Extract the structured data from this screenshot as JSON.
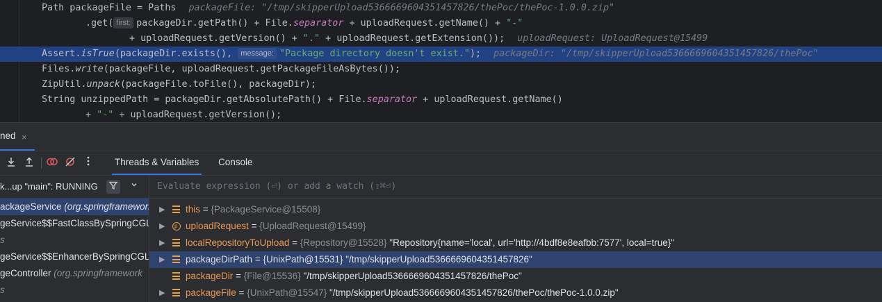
{
  "editor": {
    "lines": [
      {
        "parts": [
          "Path packageFile = Paths"
        ],
        "debug": "packageFile: \"/tmp/skipperUpload5366669604351457826/thePoc/thePoc-1.0.0.zip\""
      },
      {
        "pre": ".get(",
        "hint": "first:",
        "post_a": "packageDir.getPath() + File.",
        "field": "separator",
        "post_b": " + uploadRequest.getName() + ",
        "str": "\"-\""
      },
      {
        "pre": "+ uploadRequest.getVersion() + ",
        "str": "\".\"",
        "post": " + uploadRequest.getExtension());",
        "debug": "uploadRequest: UploadRequest@15499"
      },
      {
        "pre": "Assert.",
        "method": "isTrue",
        "post": "(packageDir.exists(), ",
        "hint": "message:",
        "str": "\"Package directory doesn't exist.\"",
        "end": ");",
        "debug": "packageDir: \"/tmp/skipperUpload5366669604351457826/thePoc\""
      },
      {
        "pre": "Files.",
        "method": "write",
        "post": "(packageFile, uploadRequest.getPackageFileAsBytes());"
      },
      {
        "pre": "ZipUtil.",
        "method": "unpack",
        "post": "(packageFile.toFile(), packageDir);"
      },
      {
        "pre": "String unzippedPath = packageDir.getAbsolutePath() + File.",
        "field": "separator",
        "post": " + uploadRequest.getName()"
      },
      {
        "pre": "+ ",
        "str": "\"-\"",
        "post": " + uploadRequest.getVersion();"
      }
    ]
  },
  "debug": {
    "session_tab": "ned",
    "close_glyph": "×",
    "tabs": [
      "Threads & Variables",
      "Console"
    ],
    "thread_label": "k...up \"main\": RUNNING",
    "frames": [
      {
        "name": "ackageService",
        "pkg": " (org.springframework."
      },
      {
        "name": "geService$$FastClassBySpringCGL",
        "pkg": ""
      },
      {
        "name": "s",
        "pkg": ""
      },
      {
        "name": "geService$$EnhancerBySpringCGL",
        "pkg": ""
      },
      {
        "name": "geController",
        "pkg": " (org.springframework"
      },
      {
        "name": "s",
        "pkg": ""
      }
    ],
    "eval_placeholder": "Evaluate expression (⏎) or add a watch (⇧⌘⏎)",
    "variables": [
      {
        "icon": "field",
        "name": "this",
        "type": "{PackageService@15508}",
        "value": ""
      },
      {
        "icon": "param",
        "name": "uploadRequest",
        "type": "{UploadRequest@15499}",
        "value": ""
      },
      {
        "icon": "field",
        "name": "localRepositoryToUpload",
        "type": "{Repository@15528}",
        "value": "\"Repository{name='local', url='http://4bdf8e8eafbb:7577', local=true}\""
      },
      {
        "icon": "field",
        "name": "packageDirPath",
        "type": "{UnixPath@15531}",
        "value": "\"/tmp/skipperUpload5366669604351457826\""
      },
      {
        "icon": "field",
        "name": "packageDir",
        "type": "{File@15536}",
        "value": "\"/tmp/skipperUpload5366669604351457826/thePoc\""
      },
      {
        "icon": "field",
        "name": "packageFile",
        "type": "{UnixPath@15547}",
        "value": "\"/tmp/skipperUpload5366669604351457826/thePoc/thePoc-1.0.0.zip\""
      }
    ]
  }
}
